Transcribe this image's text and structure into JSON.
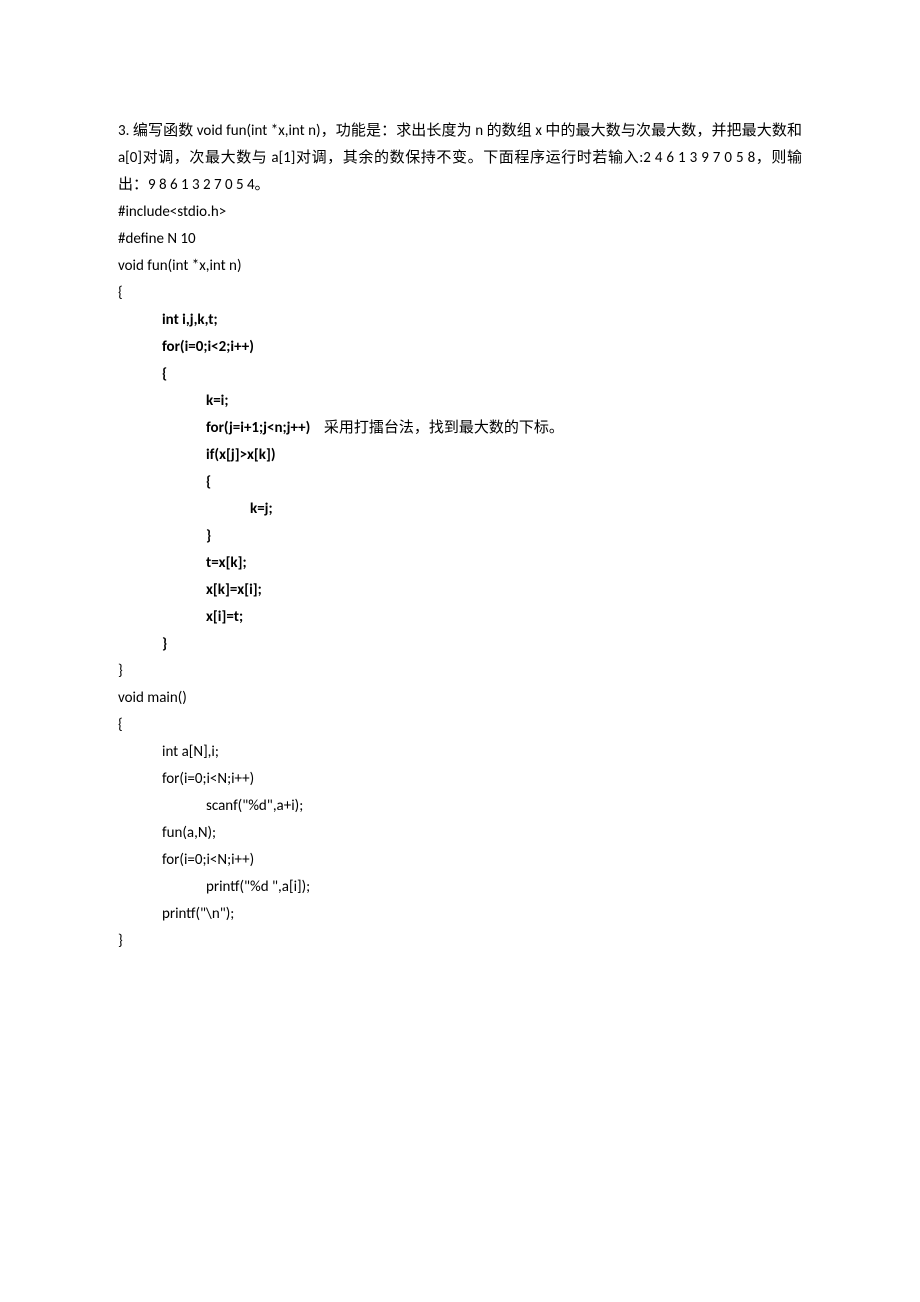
{
  "doc": {
    "p1": "3. 编写函数 void fun(int *x,int n)，功能是：求出长度为 n 的数组 x 中的最大数与次最大数，并把最大数和 a[0]对调，次最大数与 a[1]对调，其余的数保持不变。下面程序运行时若输入:2 4 6 1 3 9 7 0 5 8，则输出：9 8 6 1 3 2 7 0 5 4。",
    "c1": "#include<stdio.h>",
    "c2": "#define N 10",
    "c3": "void fun(int *x,int n)",
    "c4": "{",
    "c5": "int i,j,k,t;",
    "c6": "for(i=0;i<2;i++)",
    "c7": "{",
    "c8": "k=i;",
    "c9a": "for(j=i+1;j<n;j++)",
    "c9b": "    采用打擂台法，找到最大数的下标。",
    "c10": "if(x[j]>x[k])",
    "c11": "{",
    "c12": "k=j;",
    "c13": "}",
    "c14": "t=x[k];",
    "c15": "x[k]=x[i];",
    "c16": "x[i]=t;",
    "c17": "}",
    "c18": "}",
    "c19": "void main()",
    "c20": "{",
    "c21": "int a[N],i;",
    "c22": "for(i=0;i<N;i++)",
    "c23": "scanf(\"%d\",a+i);",
    "c24": "fun(a,N);",
    "c25": "for(i=0;i<N;i++)",
    "c26": "printf(\"%d \",a[i]);",
    "c27": "printf(\"\\n\");",
    "c28": "}"
  }
}
